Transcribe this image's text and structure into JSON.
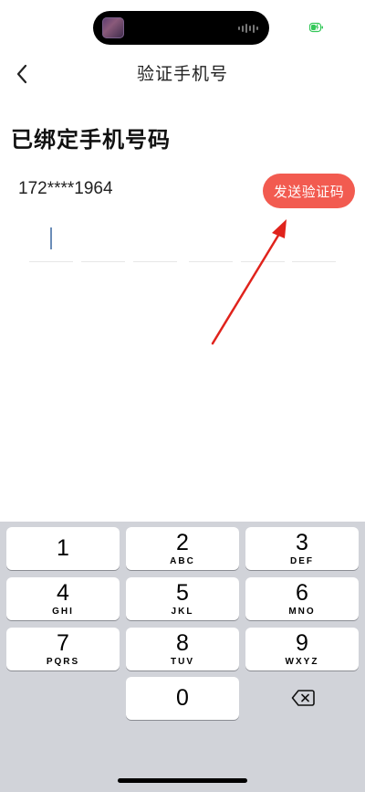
{
  "header": {
    "title": "验证手机号"
  },
  "main": {
    "heading": "已绑定手机号码",
    "phone": "172****1964",
    "send_code_label": "发送验证码"
  },
  "keyboard": {
    "keys": [
      {
        "digit": "1",
        "letters": ""
      },
      {
        "digit": "2",
        "letters": "ABC"
      },
      {
        "digit": "3",
        "letters": "DEF"
      },
      {
        "digit": "4",
        "letters": "GHI"
      },
      {
        "digit": "5",
        "letters": "JKL"
      },
      {
        "digit": "6",
        "letters": "MNO"
      },
      {
        "digit": "7",
        "letters": "PQRS"
      },
      {
        "digit": "8",
        "letters": "TUV"
      },
      {
        "digit": "9",
        "letters": "WXYZ"
      },
      {
        "digit": "0",
        "letters": ""
      }
    ]
  },
  "colors": {
    "accent": "#f25b50",
    "annotation_arrow": "#e0231c",
    "keyboard_bg": "#d1d3d9"
  },
  "icons": {
    "back": "chevron-left-icon",
    "delete": "backspace-icon",
    "battery": "battery-charging-icon"
  }
}
